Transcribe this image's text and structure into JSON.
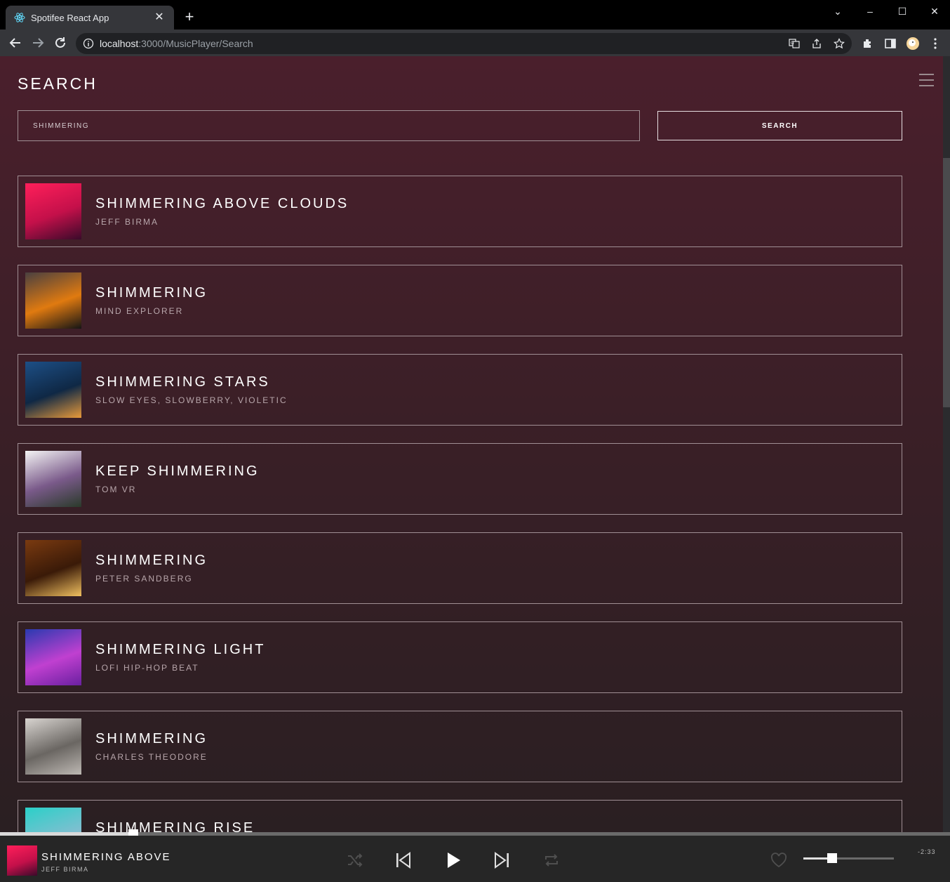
{
  "browser": {
    "tab_title": "Spotifee React App",
    "tab_close": "✕",
    "new_tab": "+",
    "url_host": "localhost",
    "url_path": ":3000/MusicPlayer/Search",
    "window_controls": {
      "dropdown": "⌄",
      "minimize": "–",
      "maximize": "☐",
      "close": "✕"
    }
  },
  "page": {
    "title": "SEARCH",
    "search": {
      "value": "SHIMMERING",
      "button_label": "SEARCH"
    },
    "results": [
      {
        "title": "SHIMMERING ABOVE CLOUDS",
        "artist": "JEFF BIRMA",
        "cover_colors": [
          "#ff1f5a",
          "#c4104a",
          "#3a0a2a"
        ]
      },
      {
        "title": "SHIMMERING",
        "artist": "MIND EXPLORER",
        "cover_colors": [
          "#4a4040",
          "#e07a10",
          "#151515"
        ]
      },
      {
        "title": "SHIMMERING STARS",
        "artist": "SLOW EYES, SLOWBERRY, VIOLETIC",
        "cover_colors": [
          "#1d4f86",
          "#0f2845",
          "#e89a3a"
        ]
      },
      {
        "title": "KEEP SHIMMERING",
        "artist": "TOM VR",
        "cover_colors": [
          "#f4f4f4",
          "#7a5a8a",
          "#2a3a2a"
        ]
      },
      {
        "title": "SHIMMERING",
        "artist": "PETER SANDBERG",
        "cover_colors": [
          "#7a3a10",
          "#3a1a08",
          "#f0c060"
        ]
      },
      {
        "title": "SHIMMERING LIGHT",
        "artist": "LOFI HIP-HOP BEAT",
        "cover_colors": [
          "#2a3ab0",
          "#c040d0",
          "#6a20a0"
        ]
      },
      {
        "title": "SHIMMERING",
        "artist": "CHARLES THEODORE",
        "cover_colors": [
          "#d8d4d0",
          "#6a6662",
          "#bdb8b3"
        ]
      },
      {
        "title": "SHIMMERING RISE",
        "artist": "",
        "cover_colors": [
          "#2ad0c8",
          "#7fbfd0",
          "#d8a0b0"
        ]
      }
    ]
  },
  "player": {
    "now_playing_title": "SHIMMERING ABOVE",
    "now_playing_artist": "JEFF BIRMA",
    "time_remaining": "-2:33",
    "progress_fraction": 0.14,
    "volume_fraction": 0.32
  },
  "colors": {
    "accent": "#ffffff",
    "border": "#a08f94",
    "background_top": "#4a1f2c",
    "background_bottom": "#2a1f22",
    "player_bg": "#262626"
  }
}
